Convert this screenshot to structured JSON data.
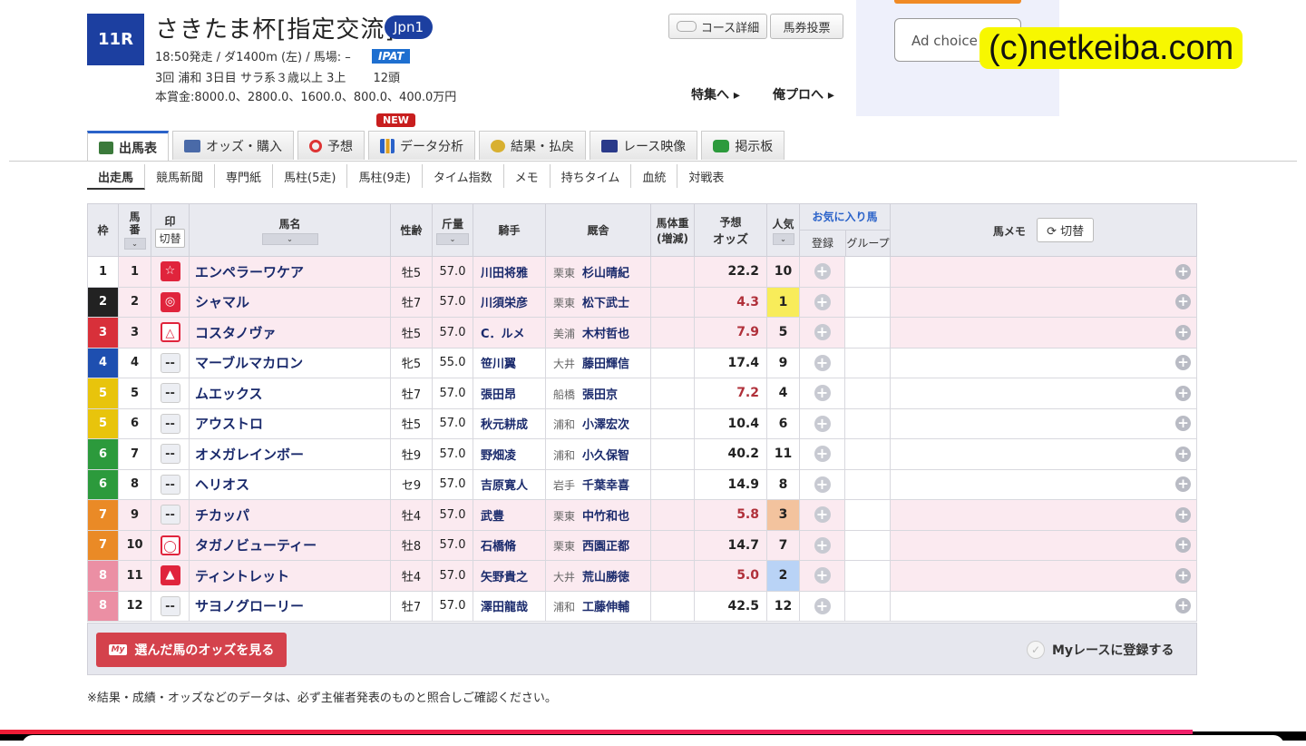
{
  "header": {
    "race_no": "11R",
    "title": "さきたま杯[指定交流]",
    "grade": "Jpn1",
    "info1": "18:50発走 / ダ1400m (左) / 馬場: –",
    "ipat": "IPAT",
    "info2": "3回 浦和 3日目 サラ系３歳以上 3上　　 12頭",
    "info3": "本賞金:8000.0、2800.0、1600.0、800.0、400.0万円",
    "course_btn": "コース詳細",
    "ticket_btn": "馬券投票",
    "feature_link": "特集へ",
    "pro_link": "俺プロへ",
    "ad_choice": "Ad choice",
    "watermark": "(c)netkeiba.com"
  },
  "tabs": [
    {
      "label": "出馬表",
      "active": true
    },
    {
      "label": "オッズ・購入"
    },
    {
      "label": "予想"
    },
    {
      "label": "データ分析",
      "badge": "NEW"
    },
    {
      "label": "結果・払戻"
    },
    {
      "label": "レース映像"
    },
    {
      "label": "掲示板"
    }
  ],
  "subtabs": [
    "出走馬",
    "競馬新聞",
    "専門紙",
    "馬柱(5走)",
    "馬柱(9走)",
    "タイム指数",
    "メモ",
    "持ちタイム",
    "血統",
    "対戦表"
  ],
  "table": {
    "headers": {
      "waku": "枠",
      "umaban": "馬番",
      "mark": "印",
      "mark_toggle": "切替",
      "name": "馬名",
      "sexage": "性齢",
      "weight": "斤量",
      "jockey": "騎手",
      "trainer": "厩舎",
      "body": "馬体重",
      "body_sub": "(増減)",
      "odds1": "予想",
      "odds2": "オッズ",
      "pop": "人気",
      "fav": "お気に入り馬",
      "fav_reg": "登録",
      "fav_group": "グループ",
      "memo": "馬メモ",
      "memo_toggle": "切替"
    },
    "rows": [
      {
        "waku": "1",
        "waku_color": "#ffffff",
        "waku_text": "#222222",
        "umaban": "1",
        "mark": "☆",
        "mark_type": "m-star",
        "name": "エンペラーワケア",
        "sexage": "牡5",
        "weight": "57.0",
        "jockey": "川田将雅",
        "region": "栗東",
        "trainer": "杉山晴紀",
        "odds": "22.2",
        "pop": "10",
        "pink": true
      },
      {
        "waku": "2",
        "waku_color": "#222222",
        "waku_text": "#ffffff",
        "umaban": "2",
        "mark": "◎",
        "mark_type": "m-dbl",
        "name": "シャマル",
        "sexage": "牡7",
        "weight": "57.0",
        "jockey": "川須栄彦",
        "region": "栗東",
        "trainer": "松下武士",
        "odds": "4.3",
        "pop": "1",
        "pink": true
      },
      {
        "waku": "3",
        "waku_color": "#d8303a",
        "waku_text": "#ffffff",
        "umaban": "3",
        "mark": "△",
        "mark_type": "m-tri",
        "name": "コスタノヴァ",
        "sexage": "牡5",
        "weight": "57.0",
        "jockey": "C．ルメ",
        "region": "美浦",
        "trainer": "木村哲也",
        "odds": "7.9",
        "pop": "5",
        "pink": true
      },
      {
        "waku": "4",
        "waku_color": "#1e4fb0",
        "waku_text": "#ffffff",
        "umaban": "4",
        "mark": "--",
        "mark_type": "m-none",
        "name": "マーブルマカロン",
        "sexage": "牝5",
        "weight": "55.0",
        "jockey": "笹川翼",
        "region": "大井",
        "trainer": "藤田輝信",
        "odds": "17.4",
        "pop": "9",
        "pink": false
      },
      {
        "waku": "5",
        "waku_color": "#e8c40c",
        "waku_text": "#ffffff",
        "umaban": "5",
        "mark": "--",
        "mark_type": "m-none",
        "name": "ムエックス",
        "sexage": "牡7",
        "weight": "57.0",
        "jockey": "張田昂",
        "region": "船橋",
        "trainer": "張田京",
        "odds": "7.2",
        "pop": "4",
        "pink": false
      },
      {
        "waku": "5",
        "waku_color": "#e8c40c",
        "waku_text": "#ffffff",
        "umaban": "6",
        "mark": "--",
        "mark_type": "m-none",
        "name": "アウストロ",
        "sexage": "牡5",
        "weight": "57.0",
        "jockey": "秋元耕成",
        "region": "浦和",
        "trainer": "小澤宏次",
        "odds": "10.4",
        "pop": "6",
        "pink": false
      },
      {
        "waku": "6",
        "waku_color": "#2c9a3c",
        "waku_text": "#ffffff",
        "umaban": "7",
        "mark": "--",
        "mark_type": "m-none",
        "name": "オメガレインボー",
        "sexage": "牡9",
        "weight": "57.0",
        "jockey": "野畑凌",
        "region": "浦和",
        "trainer": "小久保智",
        "odds": "40.2",
        "pop": "11",
        "pink": false
      },
      {
        "waku": "6",
        "waku_color": "#2c9a3c",
        "waku_text": "#ffffff",
        "umaban": "8",
        "mark": "--",
        "mark_type": "m-none",
        "name": "ヘリオス",
        "sexage": "セ9",
        "weight": "57.0",
        "jockey": "吉原寛人",
        "region": "岩手",
        "trainer": "千葉幸喜",
        "odds": "14.9",
        "pop": "8",
        "pink": false
      },
      {
        "waku": "7",
        "waku_color": "#ea8a26",
        "waku_text": "#ffffff",
        "umaban": "9",
        "mark": "--",
        "mark_type": "m-none",
        "name": "チカッパ",
        "sexage": "牡4",
        "weight": "57.0",
        "jockey": "武豊",
        "region": "栗東",
        "trainer": "中竹和也",
        "odds": "5.8",
        "pop": "3",
        "pink": true
      },
      {
        "waku": "7",
        "waku_color": "#ea8a26",
        "waku_text": "#ffffff",
        "umaban": "10",
        "mark": "◯",
        "mark_type": "m-circ",
        "name": "タガノビューティー",
        "sexage": "牡8",
        "weight": "57.0",
        "jockey": "石橋脩",
        "region": "栗東",
        "trainer": "西園正都",
        "odds": "14.7",
        "pop": "7",
        "pink": true
      },
      {
        "waku": "8",
        "waku_color": "#eb8fa4",
        "waku_text": "#ffffff",
        "umaban": "11",
        "mark": "▲",
        "mark_type": "m-tri2",
        "name": "ティントレット",
        "sexage": "牡4",
        "weight": "57.0",
        "jockey": "矢野貴之",
        "region": "大井",
        "trainer": "荒山勝徳",
        "odds": "5.0",
        "pop": "2",
        "pink": true
      },
      {
        "waku": "8",
        "waku_color": "#eb8fa4",
        "waku_text": "#ffffff",
        "umaban": "12",
        "mark": "--",
        "mark_type": "m-none",
        "name": "サヨノグローリー",
        "sexage": "牡7",
        "weight": "57.0",
        "jockey": "澤田龍哉",
        "region": "浦和",
        "trainer": "工藤伸輔",
        "odds": "42.5",
        "pop": "12",
        "pink": false
      }
    ]
  },
  "footer": {
    "odds_btn": "選んだ馬のオッズを見る",
    "my_icon": "My",
    "myrace": "Myレースに登録する",
    "note": "※結果・成績・オッズなどのデータは、必ず主催者発表のものと照合しご確認ください。"
  }
}
